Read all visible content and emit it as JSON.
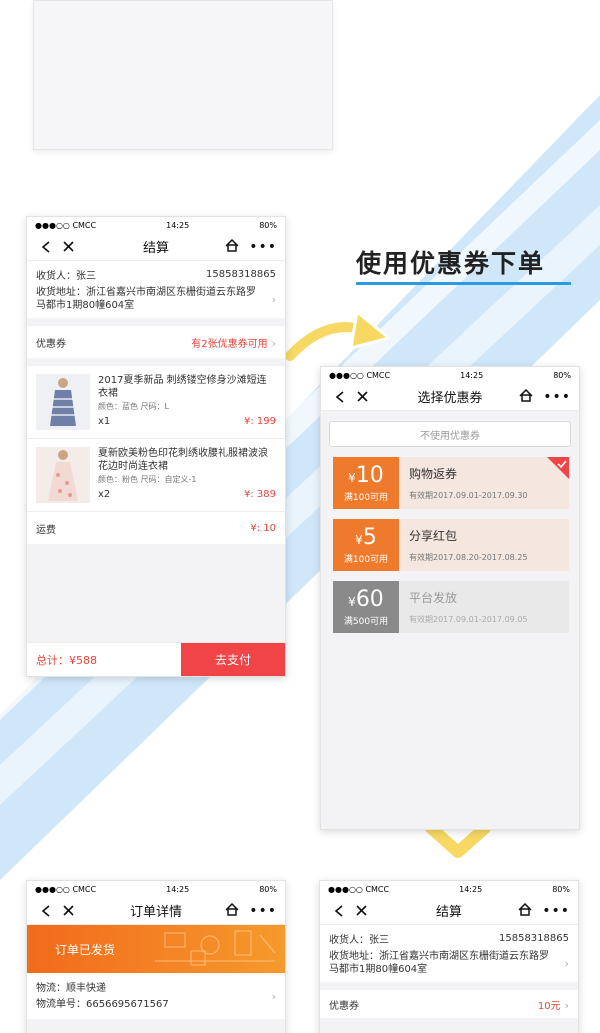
{
  "status_bar": {
    "carrier": "●●●○○ CMCC",
    "time": "14:25",
    "battery": "80%"
  },
  "section_heading": "使用优惠券下单",
  "checkout": {
    "title": "结算",
    "recipient_label": "收货人：张三",
    "phone": "15858318865",
    "address_line1": "收货地址：浙江省嘉兴市南湖区东栅街道云东路罗",
    "address_line2": "马都市1期80幢604室",
    "coupon_label": "优惠券",
    "coupon_hint": "有2张优惠券可用",
    "products": [
      {
        "name_line1": "2017夏季新品 刺绣镂空修身沙滩短连",
        "name_line2": "衣裙",
        "spec": "颜色：蓝色    尺码：L",
        "qty": "x1",
        "price": "¥: 199"
      },
      {
        "name_line1": "夏新欧美粉色印花刺绣收腰礼服裙波浪",
        "name_line2": "花边时尚连衣裙",
        "spec": "颜色：粉色    尺码：自定义-1",
        "qty": "x2",
        "price": "¥: 389"
      }
    ],
    "shipping_label": "运费",
    "shipping_value": "¥: 10",
    "total": "总计：¥588",
    "pay_button": "去支付"
  },
  "coupon_select": {
    "title": "选择优惠券",
    "no_coupon_button": "不使用优惠券",
    "coupons": [
      {
        "currency": "¥",
        "amount": "10",
        "condition": "满100可用",
        "name": "购物返券",
        "validity": "有效期2017.09.01-2017.09.30",
        "color": "#f07a2c",
        "bg": "#f5e6e0",
        "selected": true
      },
      {
        "currency": "¥",
        "amount": "5",
        "condition": "满100可用",
        "name": "分享红包",
        "validity": "有效期2017.08.20-2017.08.25",
        "color": "#f07a2c",
        "bg": "#f5e6e0",
        "selected": false
      },
      {
        "currency": "¥",
        "amount": "60",
        "condition": "满500可用",
        "name": "平台发放",
        "validity": "有效期2017.09.01-2017.09.05",
        "color": "#8a8a8a",
        "bg": "#e9e9e9",
        "selected": false
      }
    ]
  },
  "order_detail": {
    "title": "订单详情",
    "banner": "订单已发货",
    "logistics_label": "物流：",
    "logistics_value": "顺丰快递",
    "tracking_label": "物流单号：",
    "tracking_value": "6656695671567"
  },
  "checkout2": {
    "title": "结算",
    "recipient_label": "收货人：张三",
    "phone": "15858318865",
    "address_line1": "收货地址：浙江省嘉兴市南湖区东栅街道云东路罗",
    "address_line2": "马都市1期80幢604室",
    "coupon_label": "优惠券",
    "coupon_value": "10元"
  },
  "colors": {
    "accent_red": "#e8453c",
    "pay_red": "#f04447",
    "orange": "#f07a2c",
    "blue_title_line": "#2a9be2"
  }
}
